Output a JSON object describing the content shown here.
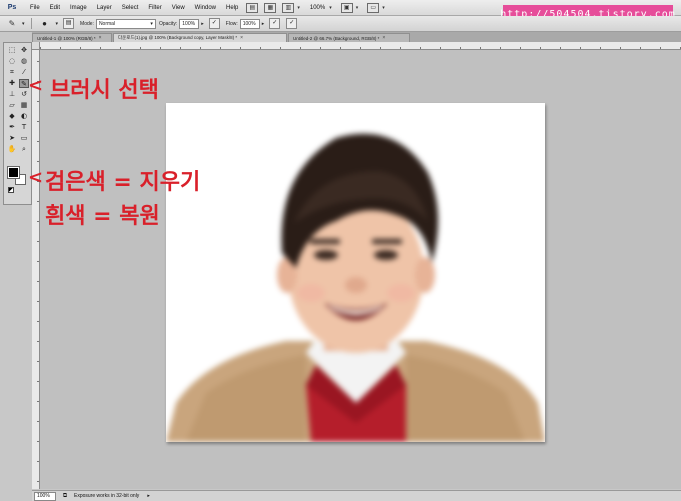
{
  "menubar": {
    "logo": "Ps",
    "items": [
      "File",
      "Edit",
      "Image",
      "Layer",
      "Select",
      "Filter",
      "View",
      "Window",
      "Help"
    ],
    "zoom": "100%",
    "icons": [
      "br-icon",
      "mb-icon",
      "layout-icon",
      "screen-mode-icon"
    ]
  },
  "watermark": "http://504504.tistory.com",
  "options": {
    "mode_label": "Mode:",
    "mode_value": "Normal",
    "opacity_label": "Opacity:",
    "opacity_value": "100%",
    "flow_label": "Flow:",
    "flow_value": "100%"
  },
  "tabs": [
    {
      "label": "Untitled-1 @ 100% (RGB/8) *",
      "active": false
    },
    {
      "label": "다운로드(1).jpg @ 100% (Background copy, Layer Mask/8) *",
      "active": true
    },
    {
      "label": "Untitled-2 @ 66.7% (Background, RGB/8) *",
      "active": false
    }
  ],
  "tab_close": "×",
  "annotations": {
    "brush_select": "브러시 선택",
    "black_erase": "검은색 = 지우기",
    "white_restore": "흰색 = 복원",
    "arrow": "<"
  },
  "status": {
    "zoom": "100%",
    "message": "Exposure works in 32-bit only"
  },
  "colors": {
    "annotation_red": "#d9202a",
    "badge_pink": "#e64d9a",
    "foreground": "#000000",
    "background": "#ffffff"
  }
}
